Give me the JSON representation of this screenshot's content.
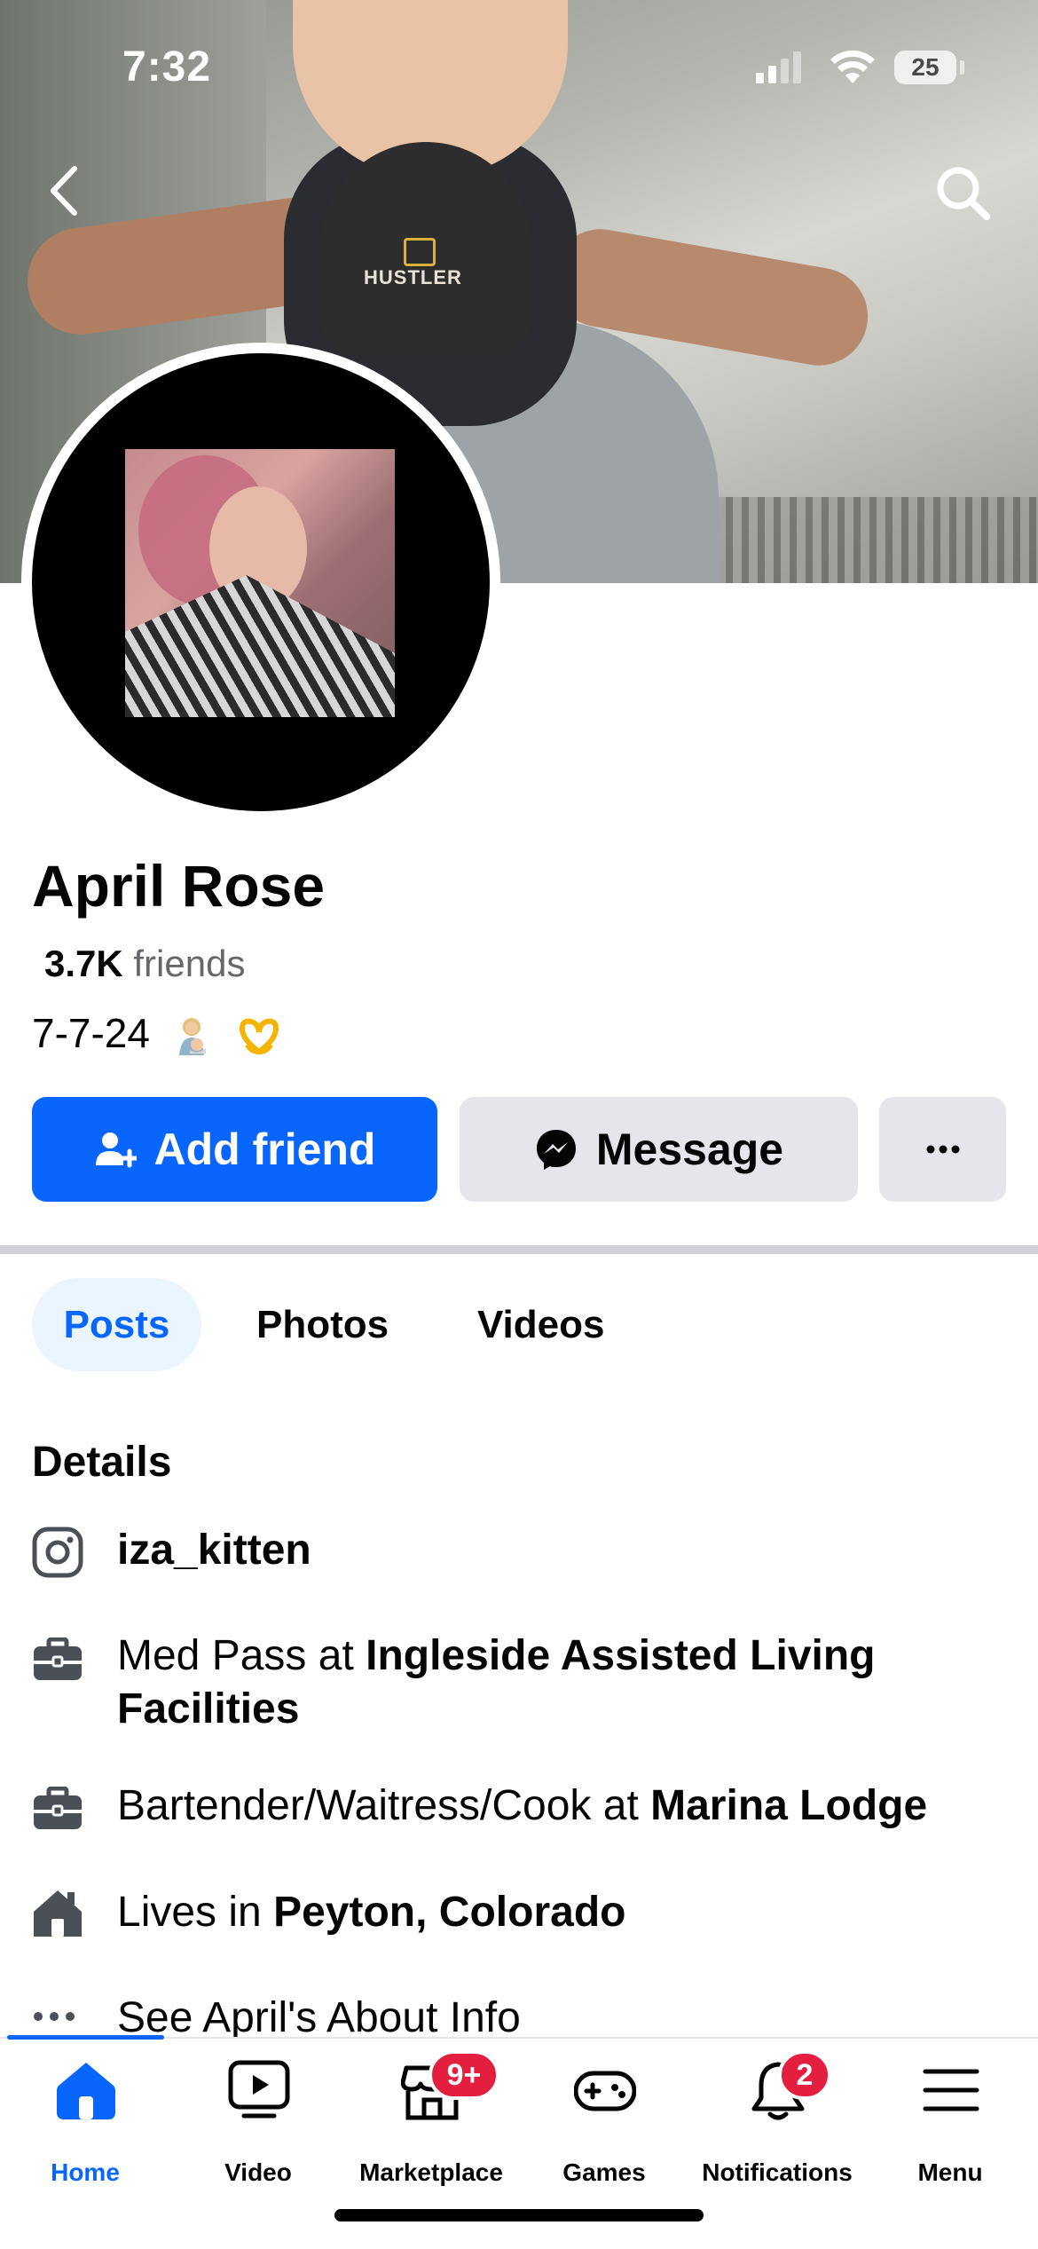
{
  "status_bar": {
    "time": "7:32",
    "battery": "25"
  },
  "profile": {
    "name": "April Rose",
    "friends_count": "3.7K",
    "friends_label": "friends",
    "bio": "7-7-24"
  },
  "actions": {
    "add_friend": "Add friend",
    "message": "Message",
    "more": "···"
  },
  "tabs": [
    "Posts",
    "Photos",
    "Videos"
  ],
  "details": {
    "title": "Details",
    "instagram": "iza_kitten",
    "work1_prefix": "Med Pass at ",
    "work1_place": "Ingleside Assisted Living Facilities",
    "work2_prefix": "Bartender/Waitress/Cook at ",
    "work2_place": "Marina Lodge",
    "lives_prefix": "Lives in ",
    "lives_place": "Peyton, Colorado",
    "about_link": "See April's About Info"
  },
  "cover": {
    "cap_text": "HUSTLER"
  },
  "bottom_nav": {
    "items": [
      {
        "label": "Home"
      },
      {
        "label": "Video"
      },
      {
        "label": "Marketplace",
        "badge": "9+"
      },
      {
        "label": "Games"
      },
      {
        "label": "Notifications",
        "badge": "2"
      },
      {
        "label": "Menu"
      }
    ]
  },
  "colors": {
    "primary": "#0866ff",
    "badge": "#e41e3f",
    "secondary_button": "#e4e6eb"
  }
}
